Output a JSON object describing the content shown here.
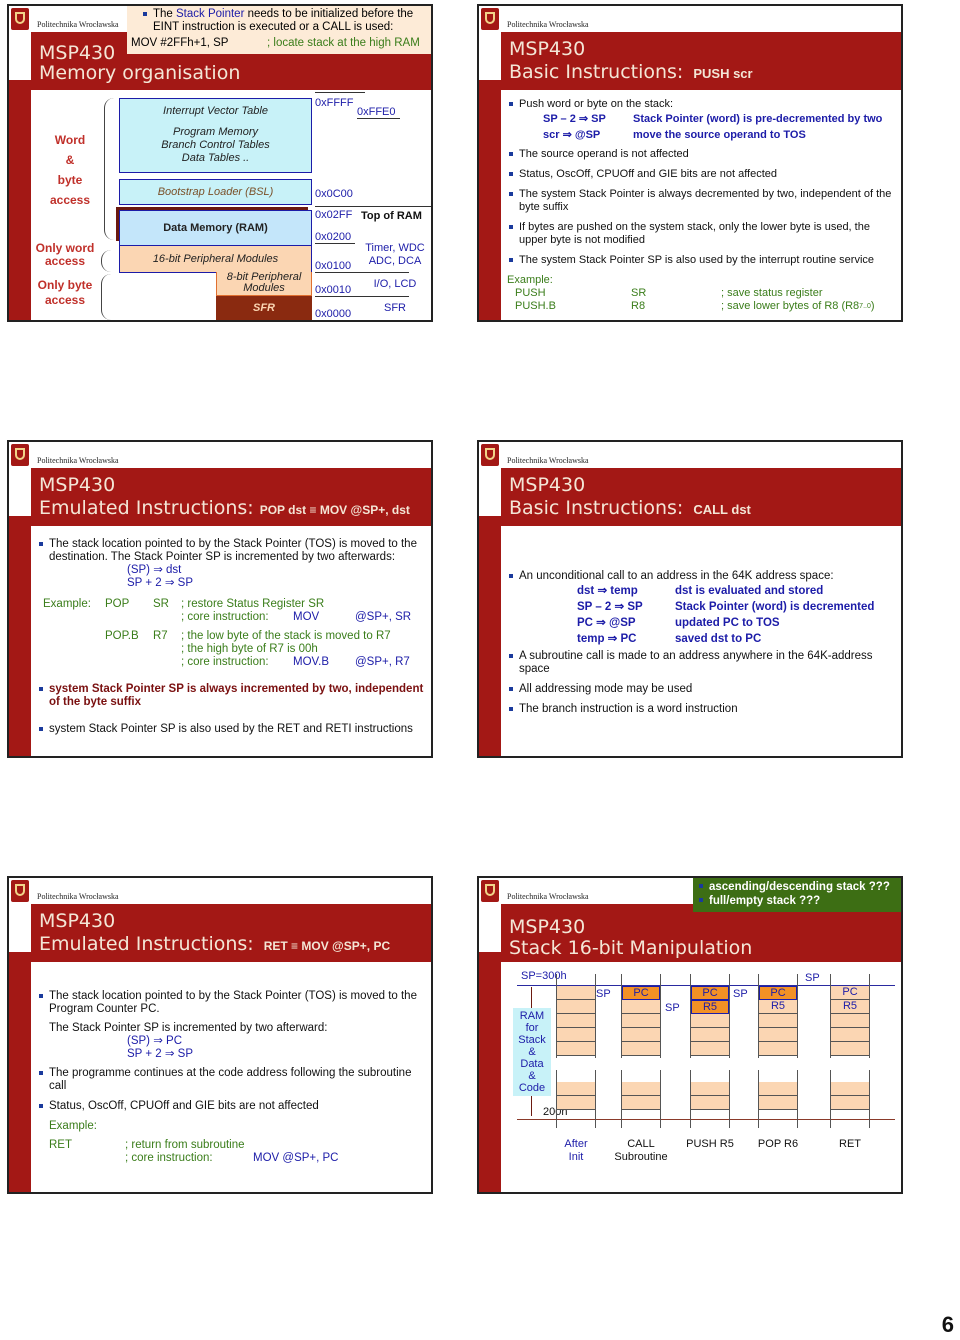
{
  "page_number": "6",
  "university": "Politechnika Wrocławska",
  "slides": [
    {
      "title_line1": "MSP430",
      "title_line2": "Memory  organisation",
      "callout": {
        "text_pre": "The ",
        "text_highlight": "Stack Pointer",
        "text_post": " needs to be initialized before the EINT instruction is executed or a CALL is used:",
        "code_instr": "MOV   #2FFh+1, SP",
        "code_comment": "; locate stack at the high RAM"
      },
      "access_labels": {
        "word_byte": [
          "Word",
          "&",
          "byte",
          "access"
        ],
        "only_word": "Only word access",
        "only_byte": "Only byte access"
      },
      "regions": {
        "ivt": "Interrupt Vector Table",
        "program_memory": [
          "Program Memory",
          "Branch Control Tables",
          "Data Tables .."
        ],
        "bsl": "Bootstrap Loader (BSL)",
        "ram": "Data Memory  (RAM)",
        "periph16": "16-bit Peripheral Modules",
        "periph8": [
          "8-bit Peripheral",
          "Modules"
        ],
        "sfr": "SFR"
      },
      "addresses": {
        "ffff": "0xFFFF",
        "ffe0": "0xFFE0",
        "0c00": "0x0C00",
        "02ff": "0x02FF",
        "0200": "0x0200",
        "0100": "0x0100",
        "0010": "0x0010",
        "0000": "0x0000"
      },
      "notes": {
        "top_of_ram": "Top of RAM",
        "timer": [
          "Timer, WDC",
          "ADC, DCA"
        ],
        "io": "I/O, LCD",
        "sfr": "SFR"
      }
    },
    {
      "title_line1": "MSP430",
      "title_line2": "Basic Instructions:",
      "title_sub": "PUSH  scr",
      "bullets": {
        "b1": "Push word or byte on the stack:",
        "ops": [
          {
            "op": "SP – 2 ⇒ SP",
            "desc": "Stack Pointer (word) is pre-decremented by two"
          },
          {
            "op": "scr ⇒ @SP",
            "desc": "move the source operand to TOS"
          }
        ],
        "b2": "The source operand is not affected",
        "b3": "Status, OscOff, CPUOff and GIE bits are not affected",
        "b4": "The system Stack Pointer is always decremented by two, independent of the byte suffix",
        "b5": "If bytes are pushed on the system stack, only the lower byte is used, the upper byte is not modified",
        "b6": "The system Stack Pointer SP is also used by the interrupt routine service"
      },
      "example": {
        "label": "Example:",
        "rows": [
          {
            "instr": "PUSH",
            "arg": "SR",
            "comment": "; save status register"
          },
          {
            "instr": "PUSH.B",
            "arg": "R8",
            "comment": "; save lower bytes of R8 (R8",
            "sub": "7..0",
            "tail": " )"
          }
        ]
      }
    },
    {
      "title_line1": "MSP430",
      "title_line2": "Emulated Instructions:",
      "title_sub": "POP dst ≡ MOV @SP+, dst",
      "bullets": {
        "b1": "The stack location pointed to by the Stack Pointer (TOS) is moved to the destination. The Stack Pointer SP is incremented by two afterwards:",
        "ops": [
          "(SP) ⇒ dst",
          "SP + 2 ⇒ SP"
        ],
        "b2": "system Stack Pointer SP is always incremented by two, independent of the byte suffix",
        "b3": "system Stack Pointer SP is also used by the RET and RETI instructions"
      },
      "example": {
        "label": "Example:",
        "pop": "POP",
        "pop_arg": "SR",
        "pop_c1": "; restore Status Register SR",
        "pop_c2": "; core instruction:",
        "pop_core": "MOV",
        "pop_core_arg": "@SP+, SR",
        "popb": "POP.B",
        "popb_arg": "R7",
        "popb_c1": "; the low byte of the stack is moved to R7",
        "popb_c2": "; the high byte of R7 is 00h",
        "popb_c3": "; core instruction:",
        "popb_core": "MOV.B",
        "popb_core_arg": "@SP+, R7"
      }
    },
    {
      "title_line1": "MSP430",
      "title_line2": "Basic Instructions:",
      "title_sub": "CALL  dst",
      "bullets": {
        "b1": "An unconditional call to an address in the 64K address space:",
        "ops": [
          {
            "op": "dst ⇒ temp",
            "desc": "dst is evaluated and stored"
          },
          {
            "op": "SP – 2 ⇒ SP",
            "desc": "Stack Pointer (word) is decremented"
          },
          {
            "op": "PC ⇒ @SP",
            "desc": "updated PC to TOS"
          },
          {
            "op": "temp ⇒ PC",
            "desc": "saved dst to PC"
          }
        ],
        "b2": "A subroutine call is made to an address anywhere in the 64K-address space",
        "b3": "All addressing mode may be used",
        "b4": "The branch instruction is a word instruction"
      }
    },
    {
      "title_line1": "MSP430",
      "title_line2": "Emulated Instructions:",
      "title_sub": "RET  ≡  MOV  @SP+, PC",
      "bullets": {
        "b1": "The stack location pointed to by the Stack Pointer (TOS) is moved to the Program Counter PC.",
        "p1": "The Stack Pointer SP is incremented by two afterward:",
        "ops": [
          "(SP) ⇒ PC",
          "SP + 2 ⇒ SP"
        ],
        "b2": "The programme continues at the code address following the subroutine call",
        "b3": "Status, OscOff, CPUOff and GIE bits are not affected"
      },
      "example": {
        "label": "Example:",
        "instr": "RET",
        "c1": "; return from subroutine",
        "c2": "; core instruction:",
        "core": "MOV   @SP+, PC"
      }
    },
    {
      "title_line1": "MSP430",
      "title_line2": "Stack 16-bit  Manipulation",
      "callout": [
        "ascending/descending stack ???",
        "full/empty stack ???"
      ],
      "diagram": {
        "sp_top": "SP=300h",
        "bottom": "200h",
        "ram_label": [
          "RAM",
          "for",
          "Stack",
          "&",
          "Data",
          "&",
          "Code"
        ],
        "sp": "SP",
        "pc": "PC",
        "r5": "R5",
        "captions": [
          [
            "After",
            "Init"
          ],
          [
            "CALL",
            "Subroutine"
          ],
          [
            "PUSH  R5"
          ],
          [
            "POP  R6"
          ],
          [
            "RET"
          ]
        ]
      }
    }
  ]
}
